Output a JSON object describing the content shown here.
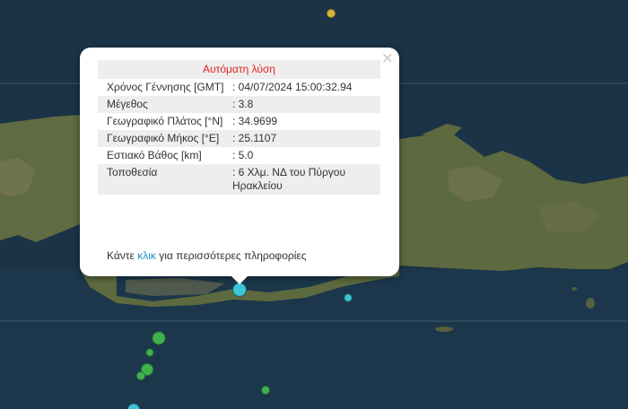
{
  "popup": {
    "close_label": "×",
    "title": "Αυτόματη λύση",
    "rows": [
      {
        "label": "Χρόνος Γέννησης [GMT]",
        "value": ": 04/07/2024 15:00:32.94"
      },
      {
        "label": "Μέγεθος",
        "value": ": 3.8"
      },
      {
        "label": "Γεωγραφικό Πλάτος [°N]",
        "value": ": 34.9699"
      },
      {
        "label": "Γεωγραφικό Μήκος [°E]",
        "value": ": 25.1107"
      },
      {
        "label": "Εστιακό Βάθος [km]",
        "value": ": 5.0"
      },
      {
        "label": "Τοποθεσία",
        "value": ": 6 Χλμ. ΝΔ του Πύργου Ηρακλείου"
      }
    ],
    "more_prefix": "Κάντε ",
    "more_link": "κλικ",
    "more_suffix": " για περισσότερες πληροφορίες"
  },
  "colors": {
    "sea": "#1b3347",
    "land": "#5d6a3f",
    "marker_yellow": "#d9b436",
    "marker_cyan": "#3cc7d8",
    "marker_green": "#3fb24f",
    "accent_red": "#e02424",
    "link_blue": "#1f8ec9"
  }
}
